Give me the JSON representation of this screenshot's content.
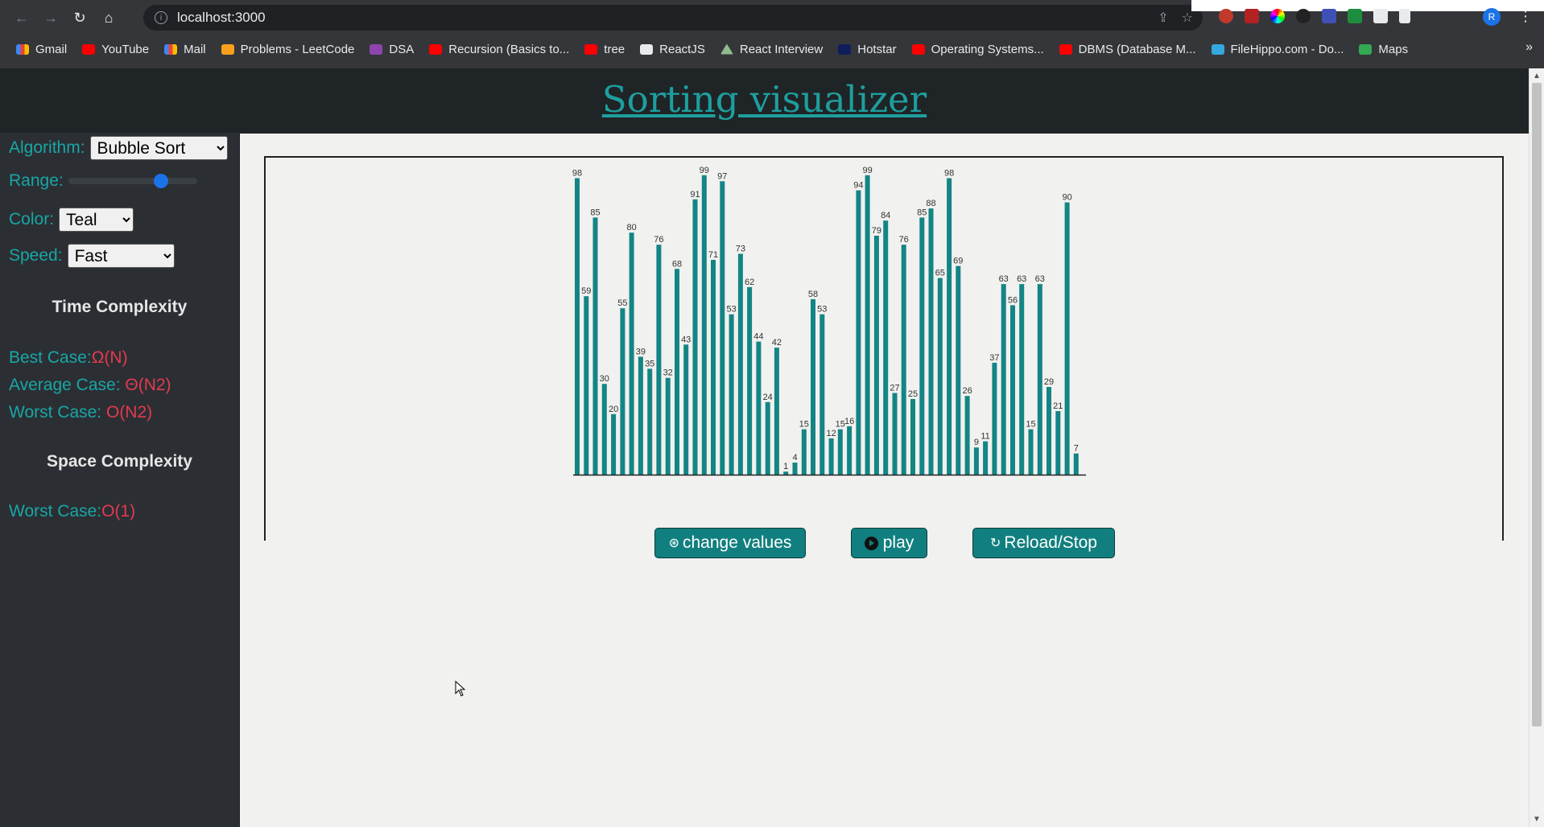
{
  "browser": {
    "url": "localhost:3000",
    "bookmarks": [
      {
        "label": "Gmail",
        "icon": "gmail-icon"
      },
      {
        "label": "YouTube",
        "icon": "youtube-icon"
      },
      {
        "label": "Mail",
        "icon": "gmail-icon"
      },
      {
        "label": "Problems - LeetCode",
        "icon": "leetcode-icon"
      },
      {
        "label": "DSA",
        "icon": "dsa-icon"
      },
      {
        "label": "Recursion (Basics to...",
        "icon": "youtube-icon"
      },
      {
        "label": "tree",
        "icon": "youtube-icon"
      },
      {
        "label": "ReactJS",
        "icon": "github-icon"
      },
      {
        "label": "React Interview",
        "icon": "react-icon"
      },
      {
        "label": "Hotstar",
        "icon": "hotstar-icon"
      },
      {
        "label": "Operating Systems...",
        "icon": "youtube-icon"
      },
      {
        "label": "DBMS (Database M...",
        "icon": "youtube-icon"
      },
      {
        "label": "FileHippo.com - Do...",
        "icon": "filehippo-icon"
      },
      {
        "label": "Maps",
        "icon": "maps-icon"
      }
    ],
    "more_label": "»",
    "profile_initial": "R"
  },
  "header": {
    "title": "Sorting visualizer"
  },
  "sidebar": {
    "algorithm_label": "Algorithm:",
    "algorithm_value": "Bubble Sort",
    "range_label": "Range:",
    "range_fraction": 0.75,
    "color_label": "Color:",
    "color_value": "Teal",
    "speed_label": "Speed:",
    "speed_value": "Fast",
    "time_heading": "Time Complexity",
    "best_label": "Best Case:",
    "best_value": "Ω(N)",
    "average_label": "Average Case: ",
    "average_value": "Θ(N2)",
    "worst_label": "Worst Case: ",
    "worst_value": "O(N2)",
    "space_heading": "Space Complexity",
    "space_worst_label": "Worst Case:",
    "space_worst_value": "O(1)"
  },
  "controls": {
    "change_label": "change values",
    "play_label": "play",
    "reload_label": "Reload/Stop"
  },
  "colors": {
    "bar": "#138585",
    "accent": "#19a6a6",
    "complexity": "#e53950"
  },
  "chart_data": {
    "type": "bar",
    "values": [
      98,
      59,
      85,
      30,
      20,
      55,
      80,
      39,
      35,
      76,
      32,
      68,
      43,
      91,
      99,
      71,
      97,
      53,
      73,
      62,
      44,
      24,
      42,
      1,
      4,
      15,
      58,
      53,
      12,
      15,
      16,
      94,
      99,
      79,
      84,
      27,
      76,
      25,
      85,
      88,
      65,
      98,
      69,
      26,
      9,
      11,
      37,
      63,
      56,
      63,
      15,
      63,
      29,
      21,
      90,
      7
    ],
    "ylim": [
      0,
      100
    ]
  }
}
